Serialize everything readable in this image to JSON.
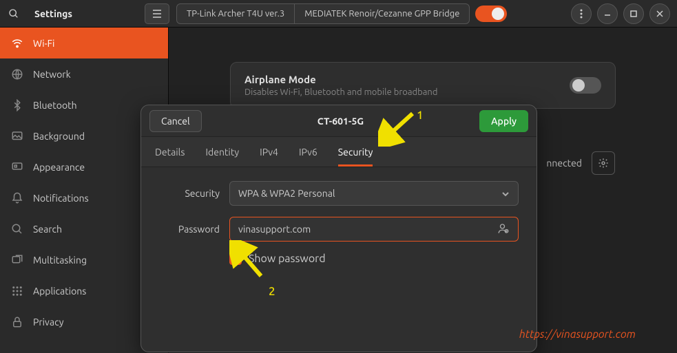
{
  "header": {
    "title": "Settings",
    "tabs": [
      "TP-Link Archer T4U ver.3",
      "MEDIATEK Renoir/Cezanne GPP Bridge"
    ]
  },
  "sidebar": {
    "items": [
      {
        "label": "Wi-Fi"
      },
      {
        "label": "Network"
      },
      {
        "label": "Bluetooth"
      },
      {
        "label": "Background"
      },
      {
        "label": "Appearance"
      },
      {
        "label": "Notifications"
      },
      {
        "label": "Search"
      },
      {
        "label": "Multitasking"
      },
      {
        "label": "Applications"
      },
      {
        "label": "Privacy"
      }
    ]
  },
  "main": {
    "airplane_title": "Airplane Mode",
    "airplane_sub": "Disables Wi-Fi, Bluetooth and mobile broadband",
    "status": "nnected"
  },
  "dialog": {
    "cancel": "Cancel",
    "apply": "Apply",
    "title": "CT-601-5G",
    "tabs": [
      "Details",
      "Identity",
      "IPv4",
      "IPv6",
      "Security"
    ],
    "security_label": "Security",
    "security_value": "WPA & WPA2 Personal",
    "password_label": "Password",
    "password_value": "vinasupport.com",
    "show_password": "Show password"
  },
  "annotations": {
    "n1": "1",
    "n2": "2",
    "watermark": "https://vinasupport.com"
  }
}
